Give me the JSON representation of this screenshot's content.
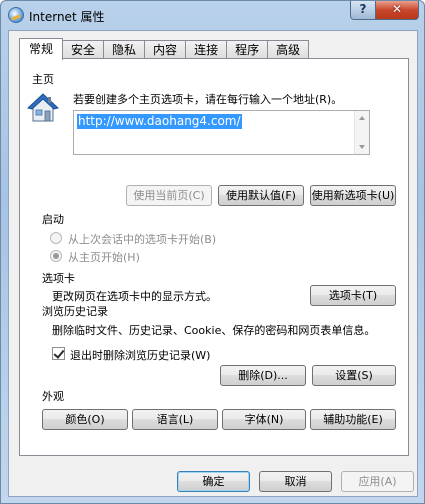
{
  "window": {
    "title": "Internet 属性",
    "help_label": "?",
    "close_label": "✕"
  },
  "tabs": [
    {
      "label": "常规"
    },
    {
      "label": "安全"
    },
    {
      "label": "隐私"
    },
    {
      "label": "内容"
    },
    {
      "label": "连接"
    },
    {
      "label": "程序"
    },
    {
      "label": "高级"
    }
  ],
  "home": {
    "title": "主页",
    "instruction": "若要创建多个主页选项卡，请在每行输入一个地址(R)。",
    "url": "http://www.daohang4.com/",
    "btn_current": "使用当前页(C)",
    "btn_default": "使用默认值(F)",
    "btn_newtab": "使用新选项卡(U)"
  },
  "startup": {
    "title": "启动",
    "option_last": "从上次会话中的选项卡开始(B)",
    "option_home": "从主页开始(H)"
  },
  "tabs_section": {
    "title": "选项卡",
    "desc": "更改网页在选项卡中的显示方式。",
    "btn": "选项卡(T)"
  },
  "history": {
    "title": "浏览历史记录",
    "desc": "删除临时文件、历史记录、Cookie、保存的密码和网页表单信息。",
    "checkbox_label": "退出时删除浏览历史记录(W)",
    "btn_delete": "删除(D)...",
    "btn_settings": "设置(S)"
  },
  "appearance": {
    "title": "外观",
    "btn_colors": "颜色(O)",
    "btn_languages": "语言(L)",
    "btn_fonts": "字体(N)",
    "btn_accessibility": "辅助功能(E)"
  },
  "footer": {
    "ok": "确定",
    "cancel": "取消",
    "apply": "应用(A)"
  }
}
